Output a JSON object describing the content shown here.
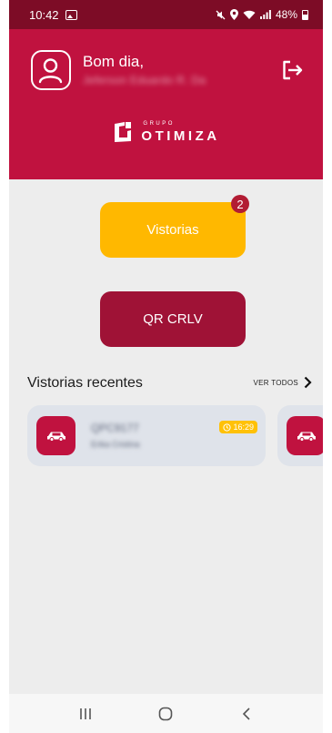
{
  "status_bar": {
    "time": "10:42",
    "battery": "48%",
    "icons": [
      "gallery-icon",
      "mute-icon",
      "location-icon",
      "wifi-icon",
      "signal-icon",
      "battery-icon"
    ]
  },
  "header": {
    "greeting": "Bom dia,",
    "user_name": "Jeferson Eduardo R. Da",
    "brand_small": "GRUPO",
    "brand_big": "OTIMIZA",
    "icons": [
      "user-avatar-icon",
      "logout-icon"
    ]
  },
  "actions": {
    "vistorias_label": "Vistorias",
    "vistorias_count": "2",
    "qr_label": "QR CRLV"
  },
  "recent": {
    "title": "Vistorias recentes",
    "see_all": "VER TODOS",
    "items": [
      {
        "plate": "QPC9177",
        "driver": "Erika Cristina",
        "time": "16:29"
      }
    ]
  },
  "colors": {
    "brand": "#c0123f",
    "status_bar": "#7d0c26",
    "accent_yellow": "#ffb800",
    "qr_button": "#9f1236",
    "card_bg": "#dfe3ea"
  },
  "nav": {
    "icons": [
      "recents-icon",
      "home-icon",
      "back-icon"
    ]
  }
}
